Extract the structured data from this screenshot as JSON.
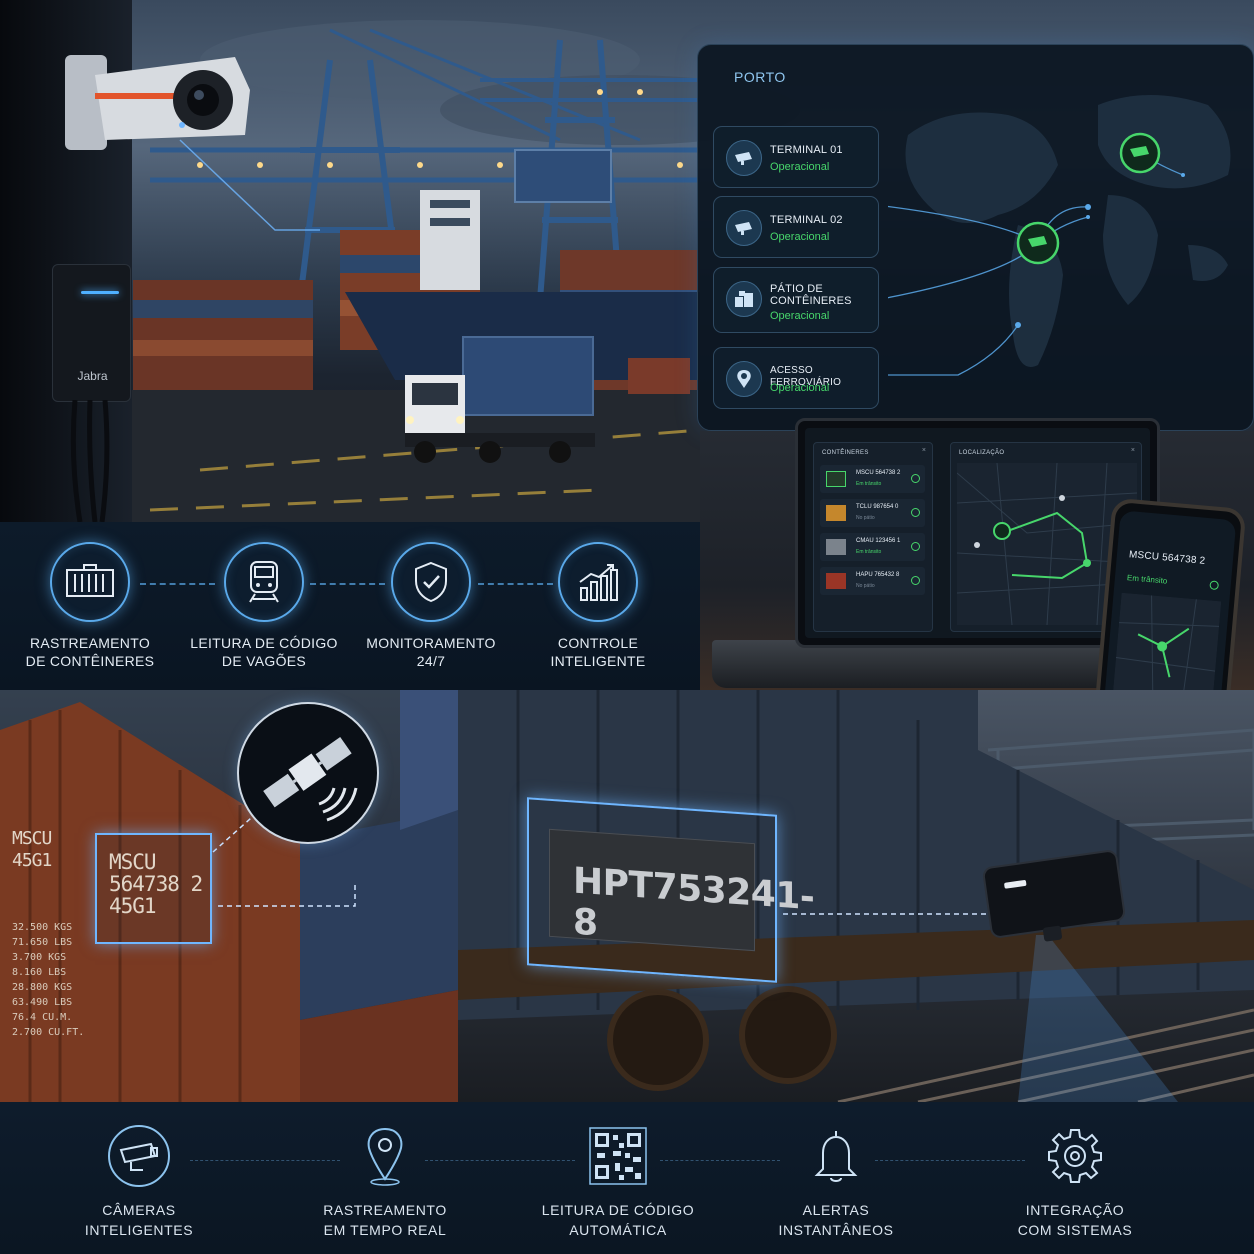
{
  "port_panel": {
    "title": "PORTO",
    "locations": [
      {
        "name": "TERMINAL 01",
        "status": "Operacional",
        "icon": "camera-icon"
      },
      {
        "name": "TERMINAL 02",
        "status": "Operacional",
        "icon": "camera-icon"
      },
      {
        "name_line1": "PÁTIO DE",
        "name_line2": "CONTÊINERES",
        "status": "Operacional",
        "icon": "container-yard-icon"
      },
      {
        "name": "ACESSO FERROVIÁRIO",
        "status": "Operacional",
        "icon": "location-pin-icon"
      }
    ]
  },
  "camera_device": {
    "brand": "Jabra"
  },
  "services": [
    {
      "line1": "RASTREAMENTO",
      "line2": "DE CONTÊINERES",
      "icon": "container-icon"
    },
    {
      "line1": "LEITURA DE CÓDIGO",
      "line2": "DE VAGÕES",
      "icon": "train-icon"
    },
    {
      "line1": "MONITORAMENTO",
      "line2": "24/7",
      "icon": "shield-check-icon"
    },
    {
      "line1": "CONTROLE",
      "line2": "INTELIGENTE",
      "icon": "growth-chart-icon"
    }
  ],
  "laptop_app": {
    "containers_title": "CONTÊINERES",
    "location_title": "LOCALIZAÇÃO",
    "containers": [
      {
        "code": "MSCU 564738 2",
        "status": "Em trânsito"
      },
      {
        "code": "TCLU 987654 0",
        "status": "No pátio"
      },
      {
        "code": "CMAU 123456 1",
        "status": "Em trânsito"
      },
      {
        "code": "HAPU 765432 8",
        "status": "No pátio"
      }
    ]
  },
  "phone_app": {
    "code": "MSCU 564738 2",
    "status": "Em trânsito"
  },
  "container_scene": {
    "label_line1": "MSCU",
    "label_line2": "564738 2",
    "label_line3": "45G1",
    "side_line1": "MSCU",
    "side_line2": "45G1",
    "weights": [
      "32.500 KGS",
      "71.650 LBS",
      "3.700 KGS",
      "8.160 LBS",
      "28.800 KGS",
      "63.490 LBS",
      "76.4 CU.M.",
      "2.700 CU.FT."
    ]
  },
  "rail_scene": {
    "wagon_code": "HPT753241-8"
  },
  "features": [
    {
      "line1": "CÂMERAS",
      "line2": "INTELIGENTES",
      "icon": "cctv-camera-icon"
    },
    {
      "line1": "RASTREAMENTO",
      "line2": "EM TEMPO REAL",
      "icon": "map-pin-icon"
    },
    {
      "line1": "LEITURA DE CÓDIGO",
      "line2": "AUTOMÁTICA",
      "icon": "qr-code-icon"
    },
    {
      "line1": "ALERTAS",
      "line2": "INSTANTÂNEOS",
      "icon": "bell-icon"
    },
    {
      "line1": "INTEGRAÇÃO",
      "line2": "COM SISTEMAS",
      "icon": "gear-icon"
    }
  ],
  "colors": {
    "accent": "#5aa9ea",
    "status_ok": "#47d66b",
    "background": "#0b1320"
  }
}
